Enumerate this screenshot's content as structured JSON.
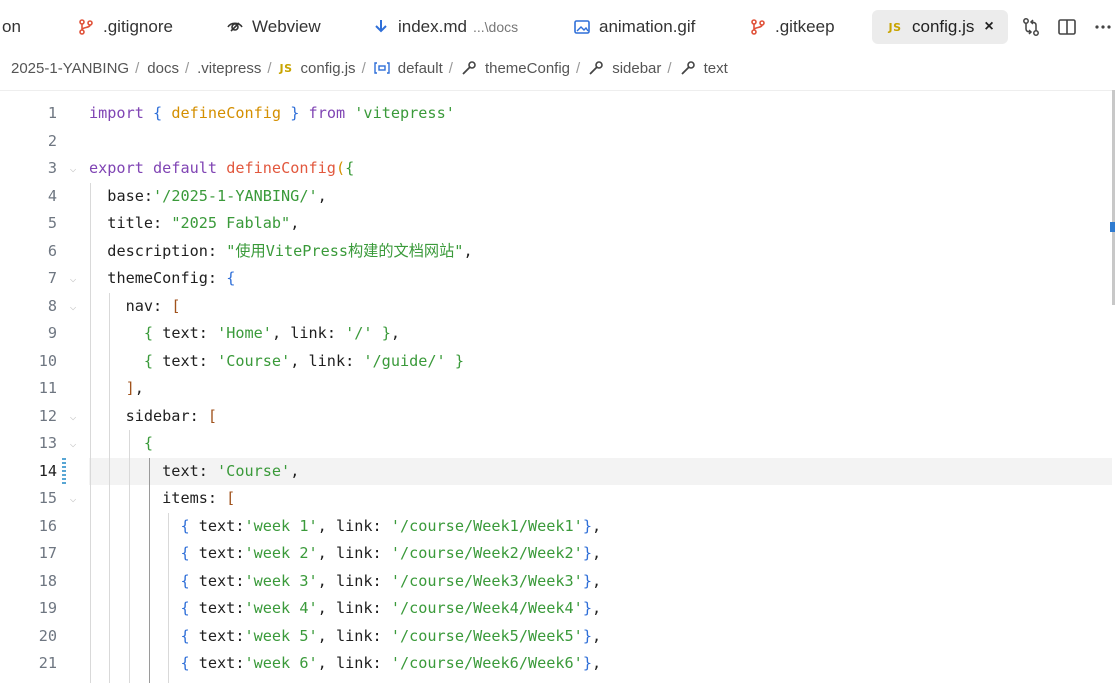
{
  "tabs": [
    {
      "label": "on",
      "icon": "none"
    },
    {
      "label": ".gitignore",
      "icon": "git-icon"
    },
    {
      "label": "Webview",
      "icon": "webview-icon"
    },
    {
      "label": "index.md",
      "description": "...\\docs",
      "icon": "markdown-download-icon"
    },
    {
      "label": "animation.gif",
      "icon": "image-icon"
    },
    {
      "label": ".gitkeep",
      "icon": "git-icon"
    },
    {
      "label": "config.js",
      "icon": "js-icon",
      "badge": "JS",
      "active": true,
      "close": "×"
    }
  ],
  "breadcrumb": [
    {
      "label": "2025-1-YANBING"
    },
    {
      "label": "docs"
    },
    {
      "label": ".vitepress"
    },
    {
      "label": "config.js",
      "badge": "JS"
    },
    {
      "label": "default",
      "icon": "variable-icon"
    },
    {
      "label": "themeConfig",
      "icon": "property-wrench-icon"
    },
    {
      "label": "sidebar",
      "icon": "property-wrench-icon"
    },
    {
      "label": "text",
      "icon": "property-wrench-icon"
    }
  ],
  "breadcrumb_separator": "/",
  "editor": {
    "current_line": 14,
    "lines": [
      {
        "n": "1",
        "fold": false,
        "t": [
          [
            "kw",
            "import"
          ],
          [
            "pun",
            " "
          ],
          [
            "p3",
            "{"
          ],
          [
            "pun",
            " "
          ],
          [
            "fn-y",
            "defineConfig"
          ],
          [
            "pun",
            " "
          ],
          [
            "p3",
            "}"
          ],
          [
            "pun",
            " "
          ],
          [
            "kw",
            "from"
          ],
          [
            "pun",
            " "
          ],
          [
            "str",
            "'vitepress'"
          ]
        ]
      },
      {
        "n": "2",
        "fold": false,
        "t": []
      },
      {
        "n": "3",
        "fold": true,
        "t": [
          [
            "kw",
            "export"
          ],
          [
            "pun",
            " "
          ],
          [
            "kw",
            "default"
          ],
          [
            "pun",
            " "
          ],
          [
            "fn",
            "defineConfig"
          ],
          [
            "p1",
            "("
          ],
          [
            "p2",
            "{"
          ]
        ]
      },
      {
        "n": "4",
        "fold": false,
        "t": [
          [
            "pun",
            "  "
          ],
          [
            "id",
            "base"
          ],
          [
            "pun",
            ":"
          ],
          [
            "str",
            "'/2025-1-YANBING/'"
          ],
          [
            "pun",
            ","
          ]
        ]
      },
      {
        "n": "5",
        "fold": false,
        "t": [
          [
            "pun",
            "  "
          ],
          [
            "id",
            "title"
          ],
          [
            "pun",
            ": "
          ],
          [
            "str",
            "\"2025 Fablab\""
          ],
          [
            "pun",
            ","
          ]
        ]
      },
      {
        "n": "6",
        "fold": false,
        "t": [
          [
            "pun",
            "  "
          ],
          [
            "id",
            "description"
          ],
          [
            "pun",
            ": "
          ],
          [
            "str",
            "\"使用VitePress构建的文档网站\""
          ],
          [
            "pun",
            ","
          ]
        ]
      },
      {
        "n": "7",
        "fold": true,
        "t": [
          [
            "pun",
            "  "
          ],
          [
            "id",
            "themeConfig"
          ],
          [
            "pun",
            ": "
          ],
          [
            "p3",
            "{"
          ]
        ]
      },
      {
        "n": "8",
        "fold": true,
        "t": [
          [
            "pun",
            "    "
          ],
          [
            "id",
            "nav"
          ],
          [
            "pun",
            ": "
          ],
          [
            "p4",
            "["
          ]
        ]
      },
      {
        "n": "9",
        "fold": false,
        "t": [
          [
            "pun",
            "      "
          ],
          [
            "p2",
            "{"
          ],
          [
            "pun",
            " "
          ],
          [
            "id",
            "text"
          ],
          [
            "pun",
            ": "
          ],
          [
            "str",
            "'Home'"
          ],
          [
            "pun",
            ", "
          ],
          [
            "id",
            "link"
          ],
          [
            "pun",
            ": "
          ],
          [
            "str",
            "'/'"
          ],
          [
            "pun",
            " "
          ],
          [
            "p2",
            "}"
          ],
          [
            "pun",
            ","
          ]
        ]
      },
      {
        "n": "10",
        "fold": false,
        "t": [
          [
            "pun",
            "      "
          ],
          [
            "p2",
            "{"
          ],
          [
            "pun",
            " "
          ],
          [
            "id",
            "text"
          ],
          [
            "pun",
            ": "
          ],
          [
            "str",
            "'Course'"
          ],
          [
            "pun",
            ", "
          ],
          [
            "id",
            "link"
          ],
          [
            "pun",
            ": "
          ],
          [
            "str",
            "'/guide/'"
          ],
          [
            "pun",
            " "
          ],
          [
            "p2",
            "}"
          ]
        ]
      },
      {
        "n": "11",
        "fold": false,
        "t": [
          [
            "pun",
            "    "
          ],
          [
            "p4",
            "]"
          ],
          [
            "pun",
            ","
          ]
        ]
      },
      {
        "n": "12",
        "fold": true,
        "t": [
          [
            "pun",
            "    "
          ],
          [
            "id",
            "sidebar"
          ],
          [
            "pun",
            ": "
          ],
          [
            "p4",
            "["
          ]
        ]
      },
      {
        "n": "13",
        "fold": true,
        "t": [
          [
            "pun",
            "      "
          ],
          [
            "p2",
            "{"
          ]
        ]
      },
      {
        "n": "14",
        "fold": false,
        "t": [
          [
            "pun",
            "        "
          ],
          [
            "id",
            "text"
          ],
          [
            "pun",
            ": "
          ],
          [
            "str",
            "'Course'"
          ],
          [
            "pun",
            ","
          ]
        ]
      },
      {
        "n": "15",
        "fold": true,
        "t": [
          [
            "pun",
            "        "
          ],
          [
            "id",
            "items"
          ],
          [
            "pun",
            ": "
          ],
          [
            "p4",
            "["
          ]
        ]
      },
      {
        "n": "16",
        "fold": false,
        "t": [
          [
            "pun",
            "          "
          ],
          [
            "p3",
            "{"
          ],
          [
            "pun",
            " "
          ],
          [
            "id",
            "text"
          ],
          [
            "pun",
            ":"
          ],
          [
            "str",
            "'week 1'"
          ],
          [
            "pun",
            ", "
          ],
          [
            "id",
            "link"
          ],
          [
            "pun",
            ": "
          ],
          [
            "str",
            "'/course/Week1/Week1'"
          ],
          [
            "p3",
            "}"
          ],
          [
            "pun",
            ","
          ]
        ]
      },
      {
        "n": "17",
        "fold": false,
        "t": [
          [
            "pun",
            "          "
          ],
          [
            "p3",
            "{"
          ],
          [
            "pun",
            " "
          ],
          [
            "id",
            "text"
          ],
          [
            "pun",
            ":"
          ],
          [
            "str",
            "'week 2'"
          ],
          [
            "pun",
            ", "
          ],
          [
            "id",
            "link"
          ],
          [
            "pun",
            ": "
          ],
          [
            "str",
            "'/course/Week2/Week2'"
          ],
          [
            "p3",
            "}"
          ],
          [
            "pun",
            ","
          ]
        ]
      },
      {
        "n": "18",
        "fold": false,
        "t": [
          [
            "pun",
            "          "
          ],
          [
            "p3",
            "{"
          ],
          [
            "pun",
            " "
          ],
          [
            "id",
            "text"
          ],
          [
            "pun",
            ":"
          ],
          [
            "str",
            "'week 3'"
          ],
          [
            "pun",
            ", "
          ],
          [
            "id",
            "link"
          ],
          [
            "pun",
            ": "
          ],
          [
            "str",
            "'/course/Week3/Week3'"
          ],
          [
            "p3",
            "}"
          ],
          [
            "pun",
            ","
          ]
        ]
      },
      {
        "n": "19",
        "fold": false,
        "t": [
          [
            "pun",
            "          "
          ],
          [
            "p3",
            "{"
          ],
          [
            "pun",
            " "
          ],
          [
            "id",
            "text"
          ],
          [
            "pun",
            ":"
          ],
          [
            "str",
            "'week 4'"
          ],
          [
            "pun",
            ", "
          ],
          [
            "id",
            "link"
          ],
          [
            "pun",
            ": "
          ],
          [
            "str",
            "'/course/Week4/Week4'"
          ],
          [
            "p3",
            "}"
          ],
          [
            "pun",
            ","
          ]
        ]
      },
      {
        "n": "20",
        "fold": false,
        "t": [
          [
            "pun",
            "          "
          ],
          [
            "p3",
            "{"
          ],
          [
            "pun",
            " "
          ],
          [
            "id",
            "text"
          ],
          [
            "pun",
            ":"
          ],
          [
            "str",
            "'week 5'"
          ],
          [
            "pun",
            ", "
          ],
          [
            "id",
            "link"
          ],
          [
            "pun",
            ": "
          ],
          [
            "str",
            "'/course/Week5/Week5'"
          ],
          [
            "p3",
            "}"
          ],
          [
            "pun",
            ","
          ]
        ]
      },
      {
        "n": "21",
        "fold": false,
        "t": [
          [
            "pun",
            "          "
          ],
          [
            "p3",
            "{"
          ],
          [
            "pun",
            " "
          ],
          [
            "id",
            "text"
          ],
          [
            "pun",
            ":"
          ],
          [
            "str",
            "'week 6'"
          ],
          [
            "pun",
            ", "
          ],
          [
            "id",
            "link"
          ],
          [
            "pun",
            ": "
          ],
          [
            "str",
            "'/course/Week6/Week6'"
          ],
          [
            "p3",
            "}"
          ],
          [
            "pun",
            ","
          ]
        ]
      }
    ]
  },
  "colors": {
    "keyword": "#8045b4",
    "string": "#3a9a3a",
    "function": "#e2583e",
    "js_badge": "#c8a400",
    "git": "#e0533b",
    "active_tab_bg": "#ececec",
    "current_line_bg": "#f3f3f3"
  }
}
